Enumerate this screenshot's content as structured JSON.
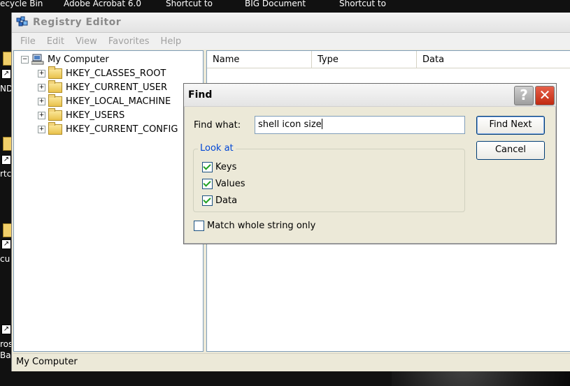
{
  "desktop": {
    "top_labels": [
      "ecycle Bin",
      "Adobe Acrobat 6.0",
      "Shortcut to",
      "BIG Document",
      "Shortcut to"
    ],
    "side_labels": [
      "ND",
      "rtc",
      "cu",
      "ros",
      "Bas"
    ]
  },
  "window": {
    "title": "Registry Editor",
    "menu": [
      "File",
      "Edit",
      "View",
      "Favorites",
      "Help"
    ],
    "tree": {
      "root": "My Computer",
      "hives": [
        "HKEY_CLASSES_ROOT",
        "HKEY_CURRENT_USER",
        "HKEY_LOCAL_MACHINE",
        "HKEY_USERS",
        "HKEY_CURRENT_CONFIG"
      ],
      "collapse_glyph": "−",
      "expand_glyph": "+"
    },
    "list_columns": [
      "Name",
      "Type",
      "Data"
    ],
    "status": "My Computer"
  },
  "find_dialog": {
    "title": "Find",
    "help_glyph": "?",
    "close_glyph": "✕",
    "find_what_label": "Find what:",
    "find_what_value": "shell icon size",
    "find_next_label": "Find Next",
    "cancel_label": "Cancel",
    "look_at_label": "Look at",
    "options": [
      {
        "label": "Keys",
        "checked": true
      },
      {
        "label": "Values",
        "checked": true
      },
      {
        "label": "Data",
        "checked": true
      }
    ],
    "match_whole": {
      "label": "Match whole string only",
      "checked": false
    }
  }
}
